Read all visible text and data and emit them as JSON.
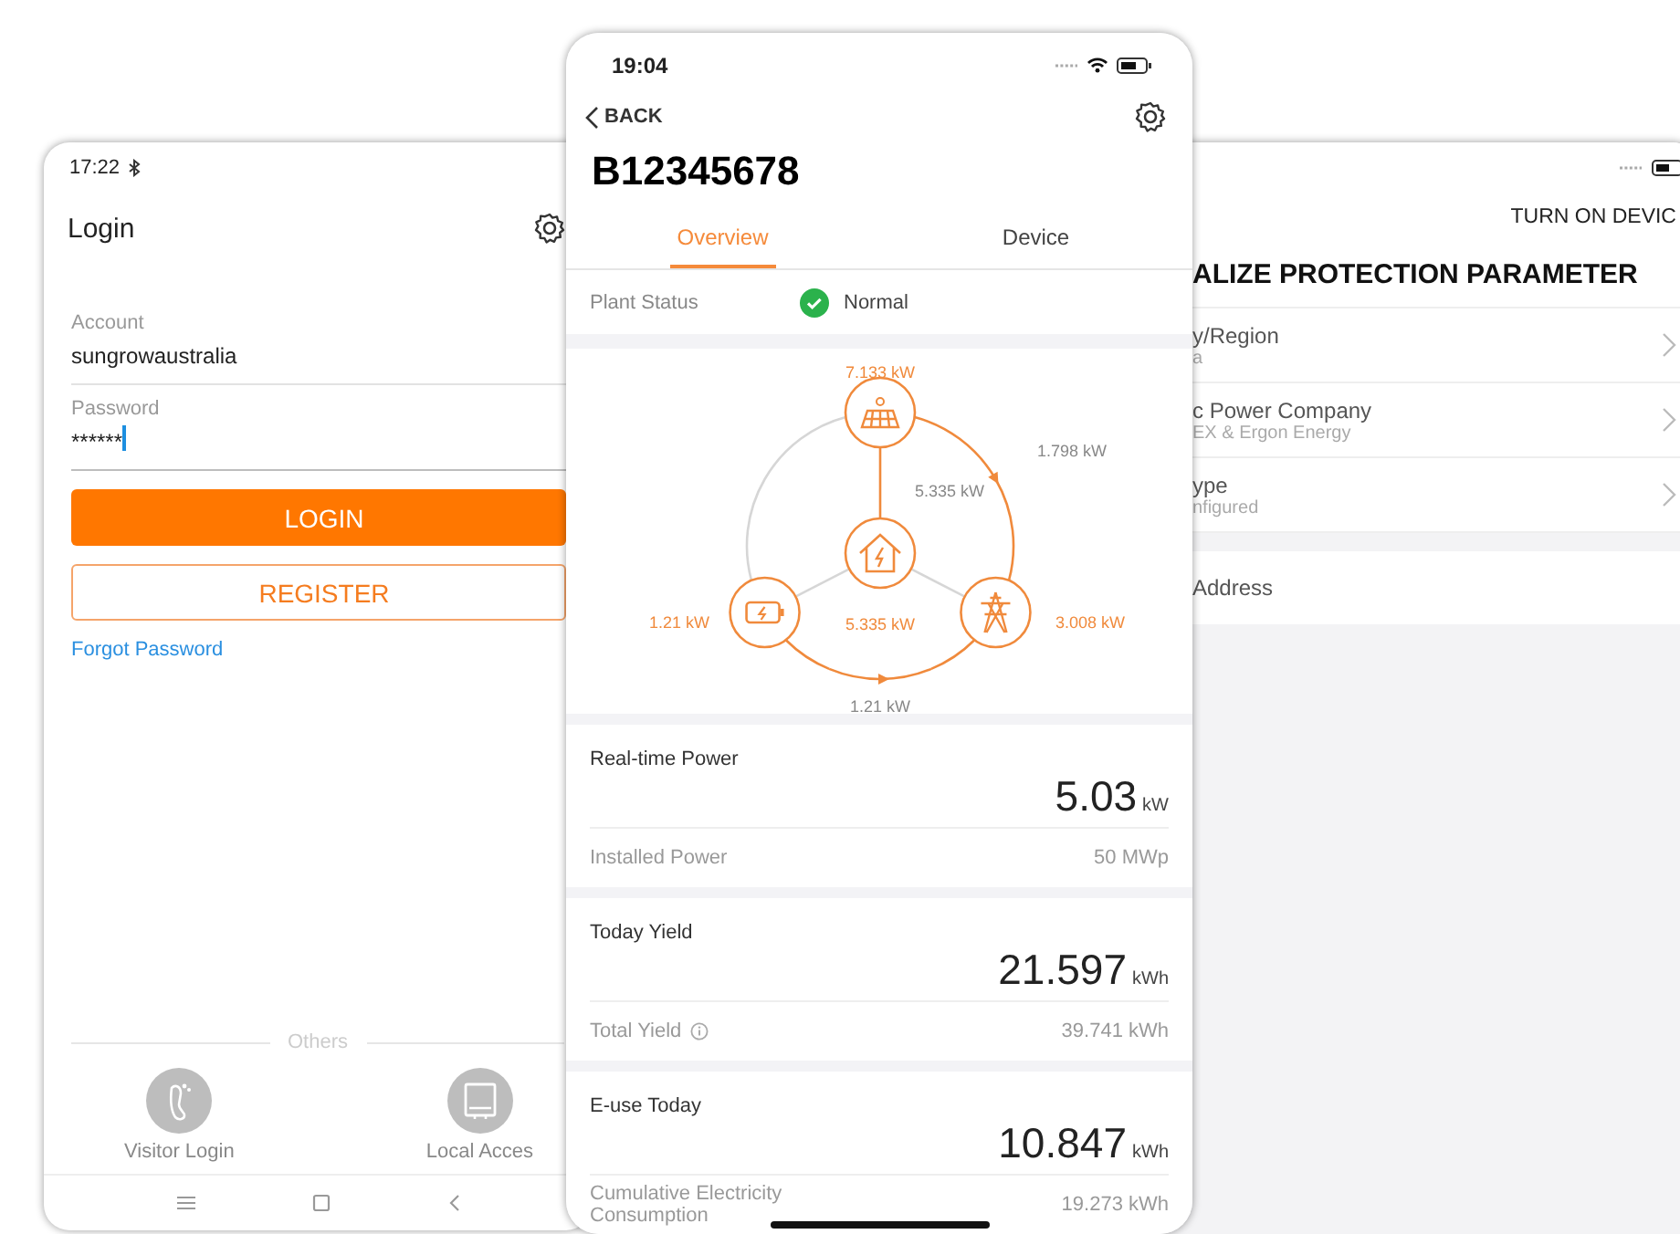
{
  "login_screen": {
    "status_time": "17:22",
    "title": "Login",
    "fields": [
      {
        "label": "Account",
        "value": "sungrowaustralia",
        "focused": false
      },
      {
        "label": "Password",
        "value": "******",
        "focused": true
      }
    ],
    "login_button": "LOGIN",
    "register_button": "REGISTER",
    "forgot_link": "Forgot Password",
    "others_label": "Others",
    "options": [
      {
        "kind": "visitor",
        "label": "Visitor Login"
      },
      {
        "kind": "local",
        "label": "Local Acces"
      }
    ]
  },
  "plant_screen": {
    "status_time": "19:04",
    "back_label": "BACK",
    "title": "B12345678",
    "tabs": [
      {
        "label": "Overview",
        "selected": true
      },
      {
        "label": "Device",
        "selected": false
      }
    ],
    "plant_status": {
      "label": "Plant Status",
      "value": "Normal"
    },
    "flow": {
      "nodes": [
        {
          "kind": "pv",
          "reading": "7.133 kW"
        },
        {
          "kind": "battery",
          "reading": "1.21 kW"
        },
        {
          "kind": "load",
          "reading": "5.335 kW"
        },
        {
          "kind": "grid",
          "reading": "3.008 kW"
        }
      ],
      "links": [
        {
          "kind": "pv_grid",
          "reading": "1.798 kW"
        },
        {
          "kind": "pv_load",
          "reading": "5.335 kW"
        },
        {
          "kind": "battery_grid",
          "reading": "1.21 kW"
        }
      ]
    },
    "cards": [
      {
        "title": "Real-time Power",
        "value": "5.03",
        "unit": "kW",
        "detail_label": "Installed Power",
        "info": false,
        "detail_value": "50 MWp"
      },
      {
        "title": "Today Yield",
        "value": "21.597",
        "unit": "kWh",
        "detail_label": "Total Yield",
        "info": true,
        "detail_value": "39.741 kWh"
      },
      {
        "title": "E-use Today",
        "value": "10.847",
        "unit": "kWh",
        "detail_label": "Cumulative Electricity Consumption",
        "info": false,
        "detail_value": "19.273 kWh"
      }
    ]
  },
  "protection_screen": {
    "action": "TURN ON DEVIC",
    "title": "ALIZE PROTECTION PARAMETER",
    "rows": [
      {
        "label": "y/Region",
        "value": "a"
      },
      {
        "label": "c Power Company",
        "value": "EX & Ergon Energy"
      },
      {
        "label": "ype",
        "value": "nfigured"
      }
    ],
    "address_label": "Address"
  }
}
